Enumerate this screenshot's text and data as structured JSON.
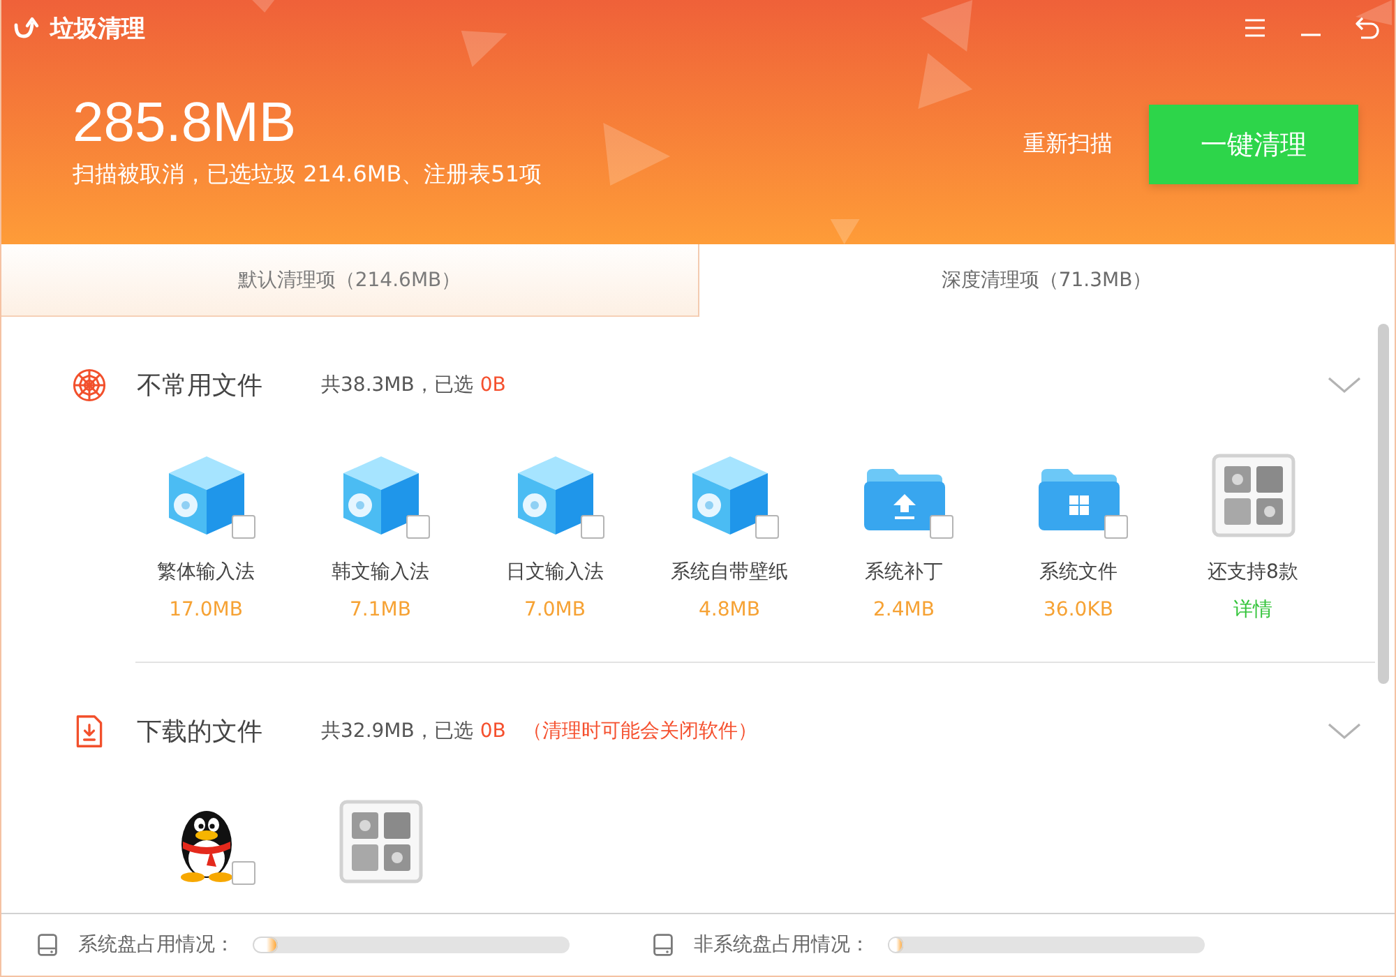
{
  "title_bar": {
    "title": "垃圾清理"
  },
  "summary": {
    "total": "285.8MB",
    "status": "扫描被取消，已选垃圾 214.6MB、注册表51项",
    "rescan": "重新扫描",
    "clean_button": "一键清理"
  },
  "tabs": [
    {
      "label": "默认清理项（214.6MB）",
      "selected": false
    },
    {
      "label": "深度清理项（71.3MB）",
      "selected": true
    }
  ],
  "sections": [
    {
      "kind": "unused",
      "title": "不常用文件",
      "total": "共38.3MB，已选",
      "selected_size": "0B",
      "items": [
        {
          "kind": "cube",
          "label": "繁体输入法",
          "size": "17.0MB",
          "checked": false
        },
        {
          "kind": "cube",
          "label": "韩文输入法",
          "size": "7.1MB",
          "checked": false
        },
        {
          "kind": "cube",
          "label": "日文输入法",
          "size": "7.0MB",
          "checked": false
        },
        {
          "kind": "cube",
          "label": "系统自带壁纸",
          "size": "4.8MB",
          "checked": false
        },
        {
          "kind": "upload",
          "label": "系统补丁",
          "size": "2.4MB",
          "checked": false
        },
        {
          "kind": "panes",
          "label": "系统文件",
          "size": "36.0KB",
          "checked": false
        },
        {
          "kind": "more",
          "label": "还支持8款",
          "link": "详情"
        }
      ]
    },
    {
      "kind": "downloads",
      "title": "下载的文件",
      "total": "共32.9MB，已选",
      "selected_size": "0B",
      "note": "（清理时可能会关闭软件）",
      "items": [
        {
          "kind": "penguin",
          "checked": false
        },
        {
          "kind": "more"
        }
      ]
    }
  ],
  "disks": [
    {
      "label": "系统盘占用情况：",
      "level": 0.08
    },
    {
      "label": "非系统盘占用情况：",
      "level": 0.05
    }
  ]
}
